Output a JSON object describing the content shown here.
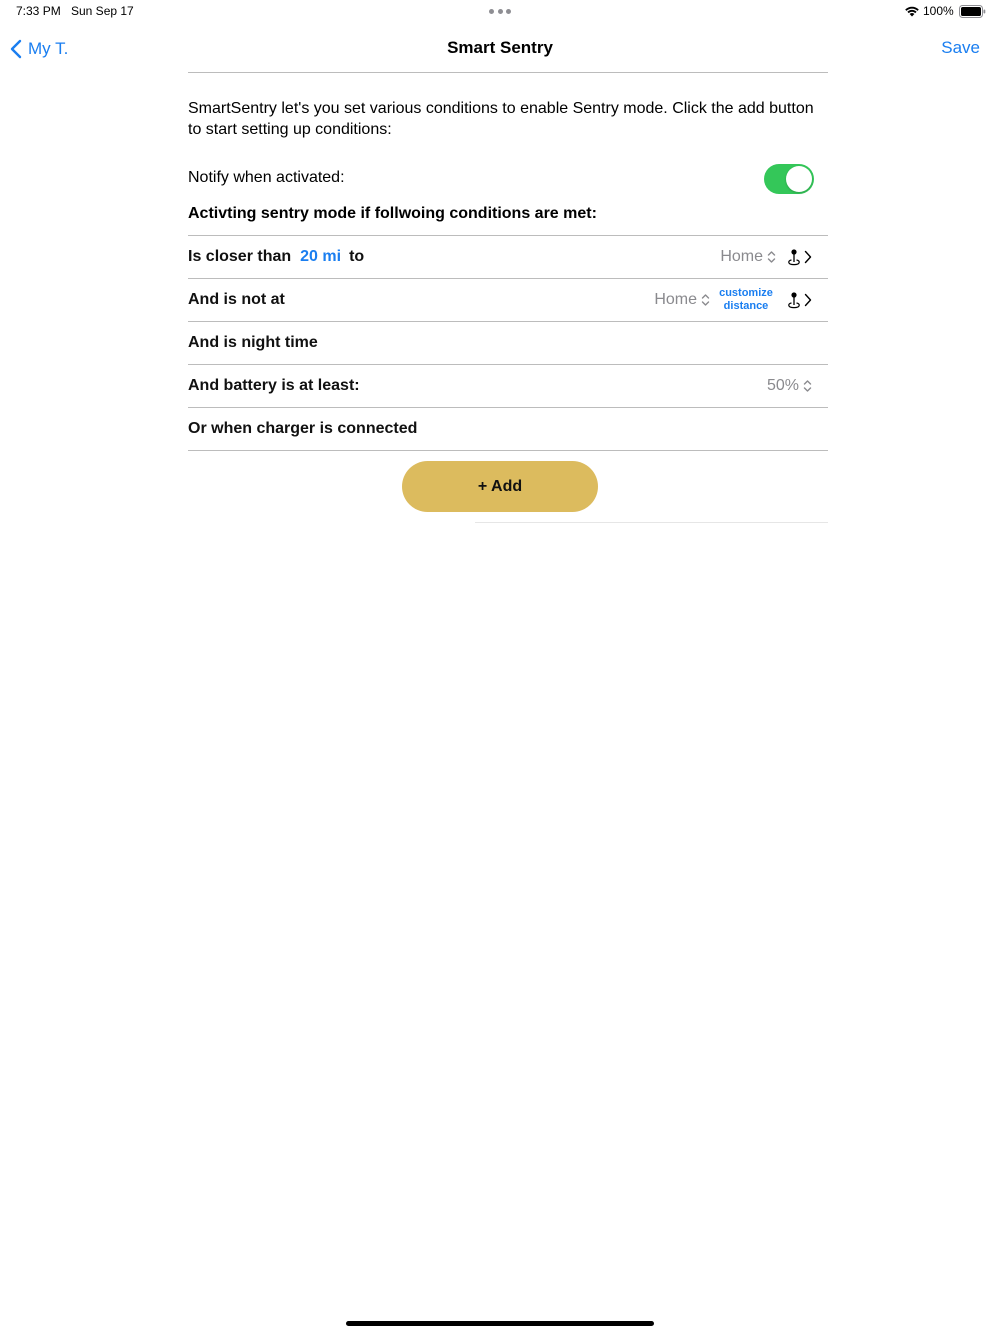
{
  "status_bar": {
    "time": "7:33 PM",
    "date": "Sun Sep 17",
    "battery_percent": "100%",
    "battery_level": 1.0,
    "icons": [
      "wifi-icon",
      "battery-icon",
      "more-dots-icon"
    ]
  },
  "nav": {
    "back_label": "My T.",
    "title": "Smart Sentry",
    "save_label": "Save"
  },
  "description": "SmartSentry let's you set various conditions to enable Sentry mode. Click the add button to start setting up conditions:",
  "notify": {
    "label": "Notify when activated:",
    "enabled": true
  },
  "conditions_heading": "Activting sentry mode if follwoing conditions are met:",
  "conditions": [
    {
      "label": "Is closer than",
      "distance": "20 mi",
      "suffix": "to",
      "location": "Home"
    },
    {
      "label": "And is not at",
      "location": "Home",
      "customize": [
        "customize",
        "distance"
      ]
    },
    {
      "label": "And is night time"
    },
    {
      "label": "And battery is at least:",
      "value": "50%"
    },
    {
      "label": "Or when charger is connected"
    }
  ],
  "add_button_label": "+ Add",
  "colors": {
    "accent": "#1a7ef0",
    "toggle_on": "#34c759",
    "add_button": "#dcbb5e",
    "picker_text": "#8a8a8e"
  }
}
